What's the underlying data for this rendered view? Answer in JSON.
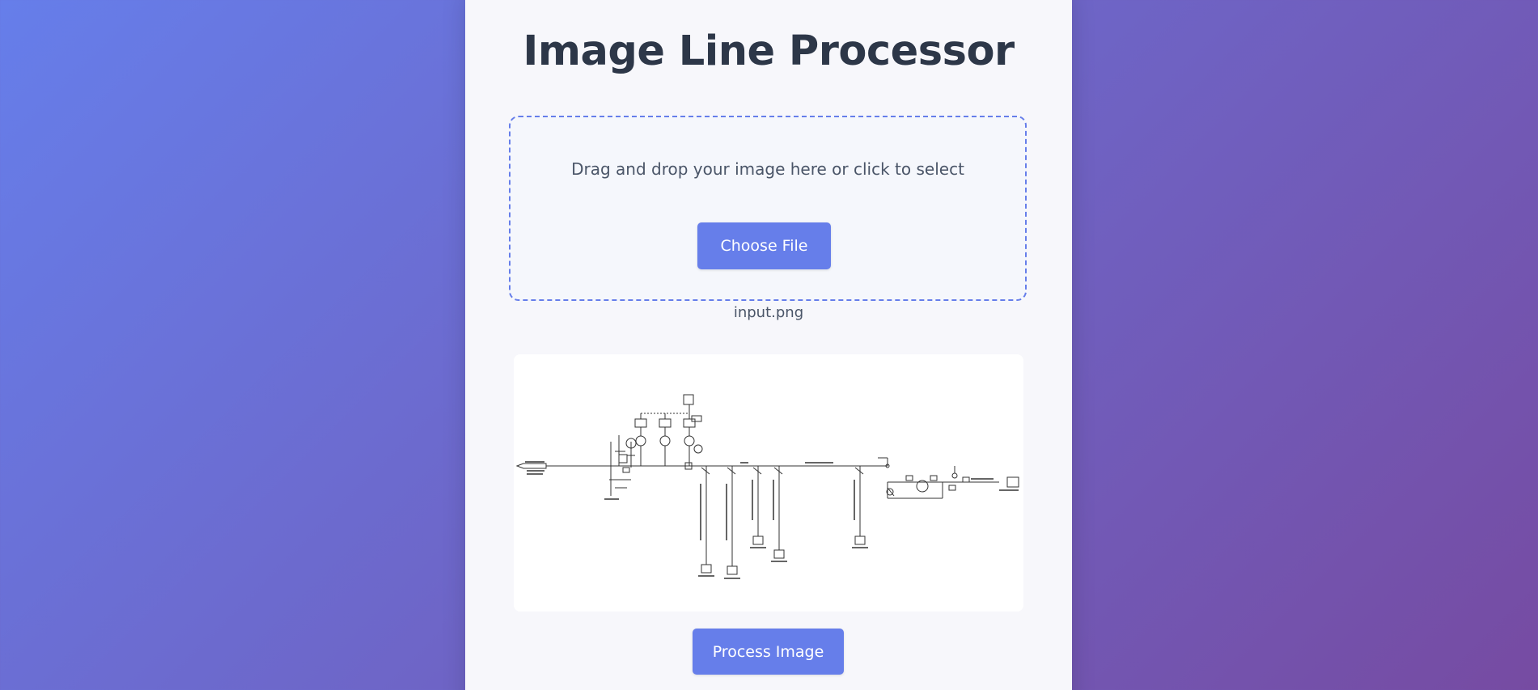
{
  "page": {
    "title": "Image Line Processor"
  },
  "upload": {
    "drop_text": "Drag and drop your image here or click to select",
    "choose_label": "Choose File"
  },
  "file": {
    "name": "input.png"
  },
  "actions": {
    "process_label": "Process Image"
  },
  "colors": {
    "accent": "#667eea",
    "gradient_start": "#667eea",
    "gradient_end": "#764ba2",
    "title": "#2d3748"
  }
}
